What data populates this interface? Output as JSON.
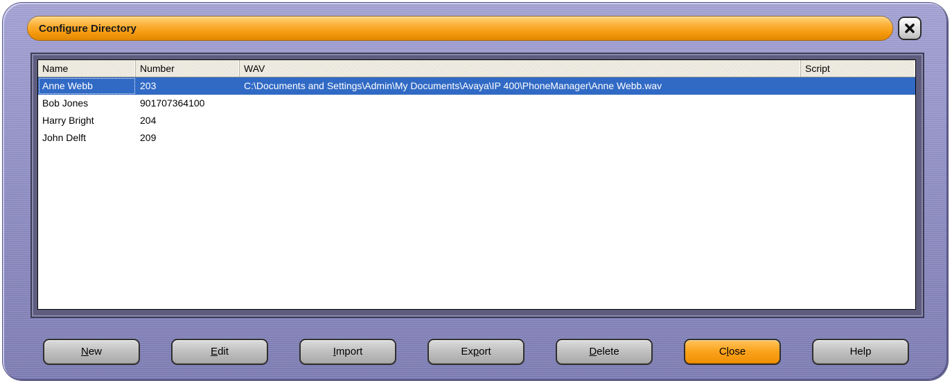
{
  "window": {
    "title": "Configure Directory"
  },
  "colors": {
    "title_bar": "#f59a0e",
    "frame": "#9897cc",
    "selection": "#316ac5",
    "primary_button": "#fba420"
  },
  "icons": {
    "close": "close-icon"
  },
  "table": {
    "columns": [
      "Name",
      "Number",
      "WAV",
      "Script"
    ],
    "rows": [
      {
        "name": "Anne Webb",
        "number": "203",
        "wav": "C:\\Documents and Settings\\Admin\\My Documents\\Avaya\\IP 400\\PhoneManager\\Anne Webb.wav",
        "script": ""
      },
      {
        "name": "Bob Jones",
        "number": "901707364100",
        "wav": "",
        "script": ""
      },
      {
        "name": "Harry Bright",
        "number": "204",
        "wav": "",
        "script": ""
      },
      {
        "name": "John Delft",
        "number": "209",
        "wav": "",
        "script": ""
      }
    ],
    "selected_row": 0
  },
  "buttons": {
    "new": {
      "label": "New",
      "mnemonic": "N"
    },
    "edit": {
      "label": "Edit",
      "mnemonic": "E"
    },
    "import": {
      "label": "Import",
      "mnemonic": "I"
    },
    "export": {
      "label": "Export",
      "mnemonic": "p"
    },
    "delete": {
      "label": "Delete",
      "mnemonic": "D"
    },
    "close": {
      "label": "Close",
      "mnemonic": "l"
    },
    "help": {
      "label": "Help",
      "mnemonic": ""
    }
  }
}
